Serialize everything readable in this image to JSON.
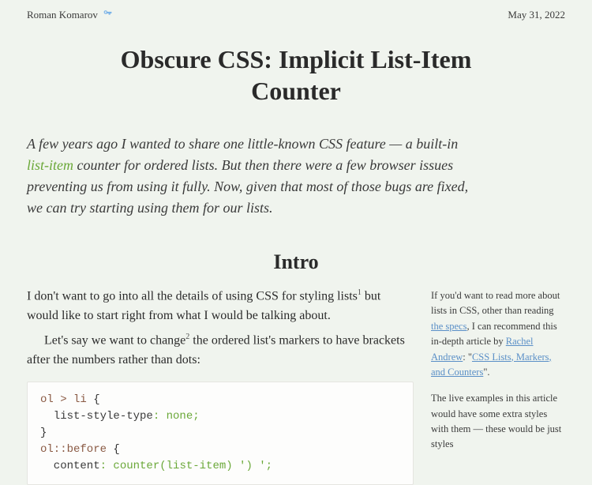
{
  "header": {
    "author": "Roman Komarov",
    "date": "May 31, 2022"
  },
  "title": "Obscure CSS: Implicit List-Item Counter",
  "intro": {
    "part1": "A few years ago I wanted to share one little-known CSS feature — a built-in ",
    "link_text": "list-item",
    "part2": " counter for ordered lists. But then there were a few browser issues preventing us from using it fully. Now, given that most of those bugs are fixed, we can try starting using them for our lists."
  },
  "section1": {
    "heading": "Intro",
    "p1_a": "I don't want to go into all the details of using CSS for styling lists",
    "p1_sup": "1",
    "p1_b": " but would like to start right from what I would be talking about.",
    "p2_a": "Let's say we want to change",
    "p2_sup": "2",
    "p2_b": " the ordered list's markers to have brackets after the numbers rather than dots:"
  },
  "code": {
    "l1_sel": "ol > li",
    "l1_brace": " {",
    "l2_prop": "  list-style-type",
    "l2_val": ": none;",
    "l3": "}",
    "l4_sel": "ol::before",
    "l4_brace": " {",
    "l5_prop": "  content",
    "l5_val": ": counter(list-item) ') ';"
  },
  "sidebar": {
    "n1_a": "If you'd want to read more about lists in CSS, other than reading ",
    "n1_link1": "the specs",
    "n1_b": ", I can recommend this in-depth article by ",
    "n1_link2": "Rachel Andrew",
    "n1_c": ": \"",
    "n1_link3": "CSS Lists, Markers, and Counters",
    "n1_d": "\".",
    "n2": "The live examples in this article would have some extra styles with them — these would be just styles"
  }
}
